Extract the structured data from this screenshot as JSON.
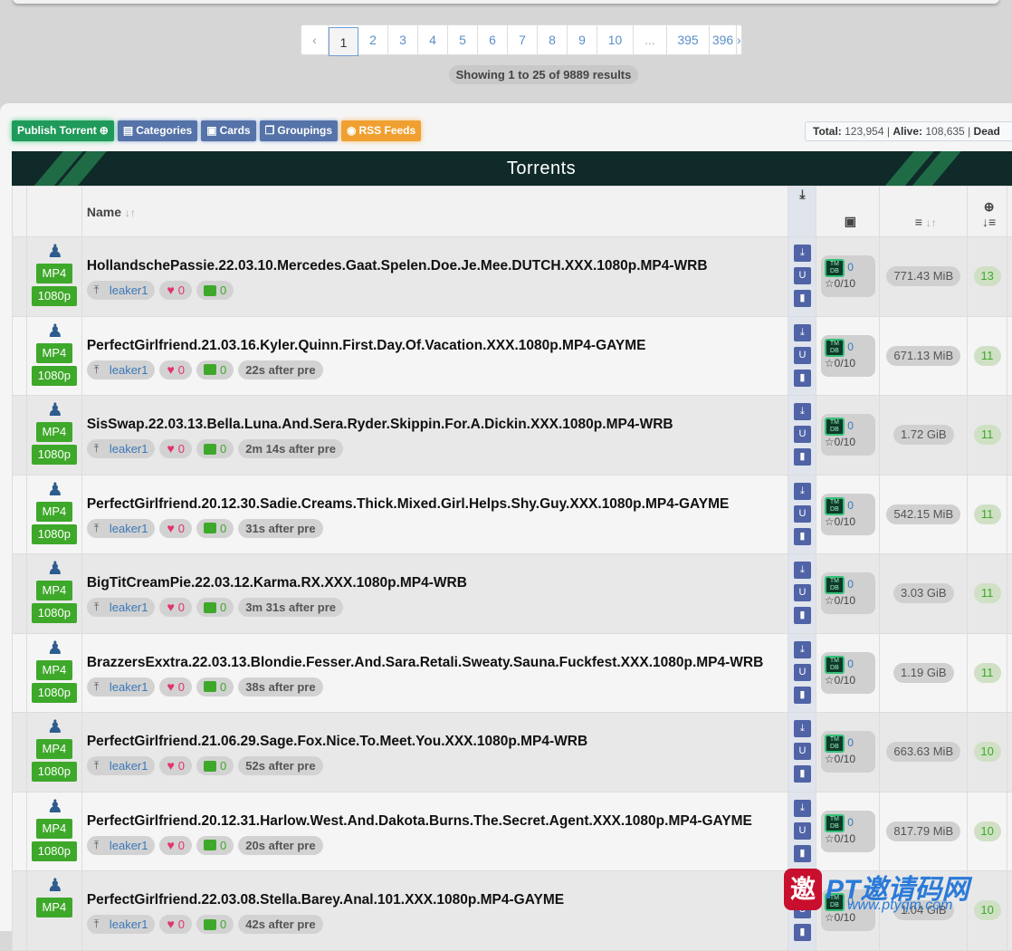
{
  "pagination": {
    "prev": "‹",
    "next": "›",
    "pages": [
      "1",
      "2",
      "3",
      "4",
      "5",
      "6",
      "7",
      "8",
      "9",
      "10",
      "...",
      "395",
      "396"
    ],
    "active": "1"
  },
  "showing": {
    "prefix": "Showing",
    "from": "1",
    "to_label": "to",
    "to": "25",
    "of_label": "of",
    "total": "9889",
    "suffix": "results"
  },
  "toolbar": {
    "publish": "Publish Torrent",
    "categories": "Categories",
    "cards": "Cards",
    "groupings": "Groupings",
    "rss": "RSS Feeds"
  },
  "stats": {
    "total_label": "Total:",
    "total": "123,954",
    "alive_label": "Alive:",
    "alive": "108,635",
    "dead_label": "Dead"
  },
  "banner_title": "Torrents",
  "table": {
    "name_header": "Name",
    "rows": [
      {
        "name": "HollandschePassie.22.03.10.Mercedes.Gaat.Spelen.Doe.Je.Mee.DUTCH.XXX.1080p.MP4-WRB",
        "format": "MP4",
        "res": "1080p",
        "uploader": "leaker1",
        "likes": "0",
        "comments": "0",
        "time": "",
        "tmdb": "0",
        "rating": "0/10",
        "size": "771.43 MiB",
        "seeders": "13"
      },
      {
        "name": "PerfectGirlfriend.21.03.16.Kyler.Quinn.First.Day.Of.Vacation.XXX.1080p.MP4-GAYME",
        "format": "MP4",
        "res": "1080p",
        "uploader": "leaker1",
        "likes": "0",
        "comments": "0",
        "time": "22s after pre",
        "tmdb": "0",
        "rating": "0/10",
        "size": "671.13 MiB",
        "seeders": "11"
      },
      {
        "name": "SisSwap.22.03.13.Bella.Luna.And.Sera.Ryder.Skippin.For.A.Dickin.XXX.1080p.MP4-WRB",
        "format": "MP4",
        "res": "1080p",
        "uploader": "leaker1",
        "likes": "0",
        "comments": "0",
        "time": "2m 14s after pre",
        "tmdb": "0",
        "rating": "0/10",
        "size": "1.72 GiB",
        "seeders": "11"
      },
      {
        "name": "PerfectGirlfriend.20.12.30.Sadie.Creams.Thick.Mixed.Girl.Helps.Shy.Guy.XXX.1080p.MP4-GAYME",
        "format": "MP4",
        "res": "1080p",
        "uploader": "leaker1",
        "likes": "0",
        "comments": "0",
        "time": "31s after pre",
        "tmdb": "0",
        "rating": "0/10",
        "size": "542.15 MiB",
        "seeders": "11"
      },
      {
        "name": "BigTitCreamPie.22.03.12.Karma.RX.XXX.1080p.MP4-WRB",
        "format": "MP4",
        "res": "1080p",
        "uploader": "leaker1",
        "likes": "0",
        "comments": "0",
        "time": "3m 31s after pre",
        "tmdb": "0",
        "rating": "0/10",
        "size": "3.03 GiB",
        "seeders": "11"
      },
      {
        "name": "BrazzersExxtra.22.03.13.Blondie.Fesser.And.Sara.Retali.Sweaty.Sauna.Fuckfest.XXX.1080p.MP4-WRB",
        "format": "MP4",
        "res": "1080p",
        "uploader": "leaker1",
        "likes": "0",
        "comments": "0",
        "time": "38s after pre",
        "tmdb": "0",
        "rating": "0/10",
        "size": "1.19 GiB",
        "seeders": "11"
      },
      {
        "name": "PerfectGirlfriend.21.06.29.Sage.Fox.Nice.To.Meet.You.XXX.1080p.MP4-WRB",
        "format": "MP4",
        "res": "1080p",
        "uploader": "leaker1",
        "likes": "0",
        "comments": "0",
        "time": "52s after pre",
        "tmdb": "0",
        "rating": "0/10",
        "size": "663.63 MiB",
        "seeders": "10"
      },
      {
        "name": "PerfectGirlfriend.20.12.31.Harlow.West.And.Dakota.Burns.The.Secret.Agent.XXX.1080p.MP4-GAYME",
        "format": "MP4",
        "res": "1080p",
        "uploader": "leaker1",
        "likes": "0",
        "comments": "0",
        "time": "20s after pre",
        "tmdb": "0",
        "rating": "0/10",
        "size": "817.79 MiB",
        "seeders": "10"
      },
      {
        "name": "PerfectGirlfriend.22.03.08.Stella.Barey.Anal.101.XXX.1080p.MP4-GAYME",
        "format": "MP4",
        "res": "",
        "uploader": "leaker1",
        "likes": "0",
        "comments": "0",
        "time": "42s after pre",
        "tmdb": "0",
        "rating": "0/10",
        "size": "1.04 GiB",
        "seeders": "10"
      }
    ]
  },
  "watermark": {
    "logo": "邀",
    "text": "PT邀请码网",
    "url": "www.ptyqm.com"
  },
  "colors": {
    "accent_green": "#3ea82a",
    "link_blue": "#3a78b8",
    "banner_bg": "#0f2a28",
    "action_blue": "#4f63a6"
  }
}
